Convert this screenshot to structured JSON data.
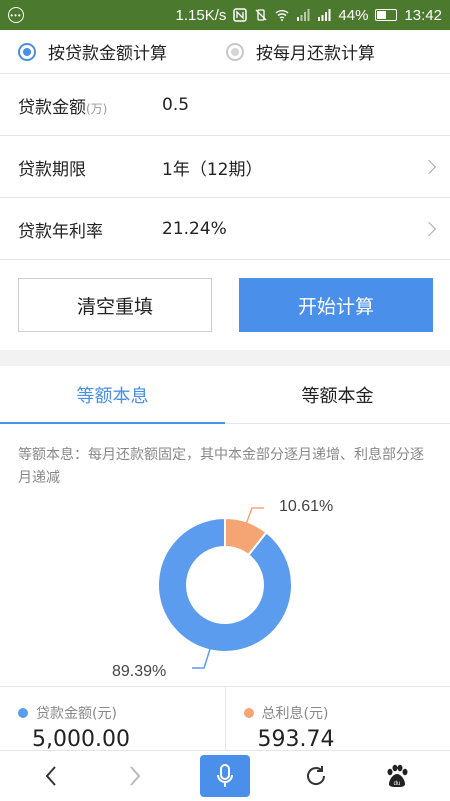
{
  "status_bar": {
    "speed": "1.15K/s",
    "battery": "44%",
    "time": "13:42"
  },
  "mode": {
    "option1": "按贷款金额计算",
    "option2": "按每月还款计算",
    "selected": "option1"
  },
  "fields": {
    "amount": {
      "label": "贷款金额",
      "unit": "(万)",
      "value": "0.5"
    },
    "term": {
      "label": "贷款期限",
      "value": "1年（12期）"
    },
    "rate": {
      "label": "贷款年利率",
      "value": "21.24%"
    }
  },
  "buttons": {
    "clear": "清空重填",
    "start": "开始计算"
  },
  "tabs": [
    {
      "label": "等额本息",
      "active": true
    },
    {
      "label": "等额本金",
      "active": false
    }
  ],
  "description": "等额本息：每月还款额固定，其中本金部分逐月递增、利息部分逐月递减",
  "chart_data": {
    "type": "pie",
    "donut": true,
    "slices": [
      {
        "label": "89.39%",
        "value": 89.39,
        "color": "#5b9cef"
      },
      {
        "label": "10.61%",
        "value": 10.61,
        "color": "#f5a573"
      }
    ]
  },
  "summary": {
    "principal": {
      "label": "贷款金额(元)",
      "value": "5,000.00",
      "color": "#5b9cef"
    },
    "interest": {
      "label": "总利息(元)",
      "value": "593.74",
      "color": "#f5a573"
    }
  },
  "colors": {
    "accent": "#4a8fea",
    "status_bar": "#4b7a2e"
  }
}
